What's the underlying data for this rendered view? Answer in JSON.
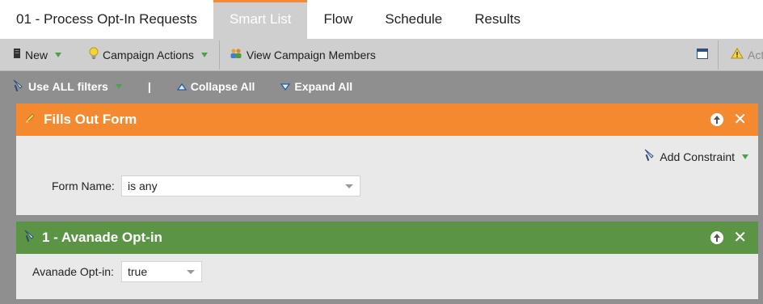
{
  "tabs": {
    "title": "01 - Process Opt-In Requests",
    "smart_list": "Smart List",
    "flow": "Flow",
    "schedule": "Schedule",
    "results": "Results"
  },
  "toolbar": {
    "new": "New",
    "campaign_actions": "Campaign Actions",
    "view_members": "View Campaign Members",
    "activate_partial": "Act"
  },
  "filterbar": {
    "use_prefix": "Use ",
    "use_strong": "ALL",
    "use_suffix": " filters",
    "separator": "|",
    "collapse": "Collapse All",
    "expand": "Expand All"
  },
  "filters": [
    {
      "title": "Fills Out Form",
      "add_constraint": "Add Constraint",
      "field_label": "Form Name:",
      "field_value": "is any"
    },
    {
      "title": "1 - Avanade Opt-in",
      "field_label": "Avanade Opt-in:",
      "field_value": "true"
    }
  ],
  "colors": {
    "active_tab_accent": "#f58a34",
    "form_header": "#f5892f",
    "optin_header": "#5c9445",
    "caret_green": "#4aa34a"
  }
}
